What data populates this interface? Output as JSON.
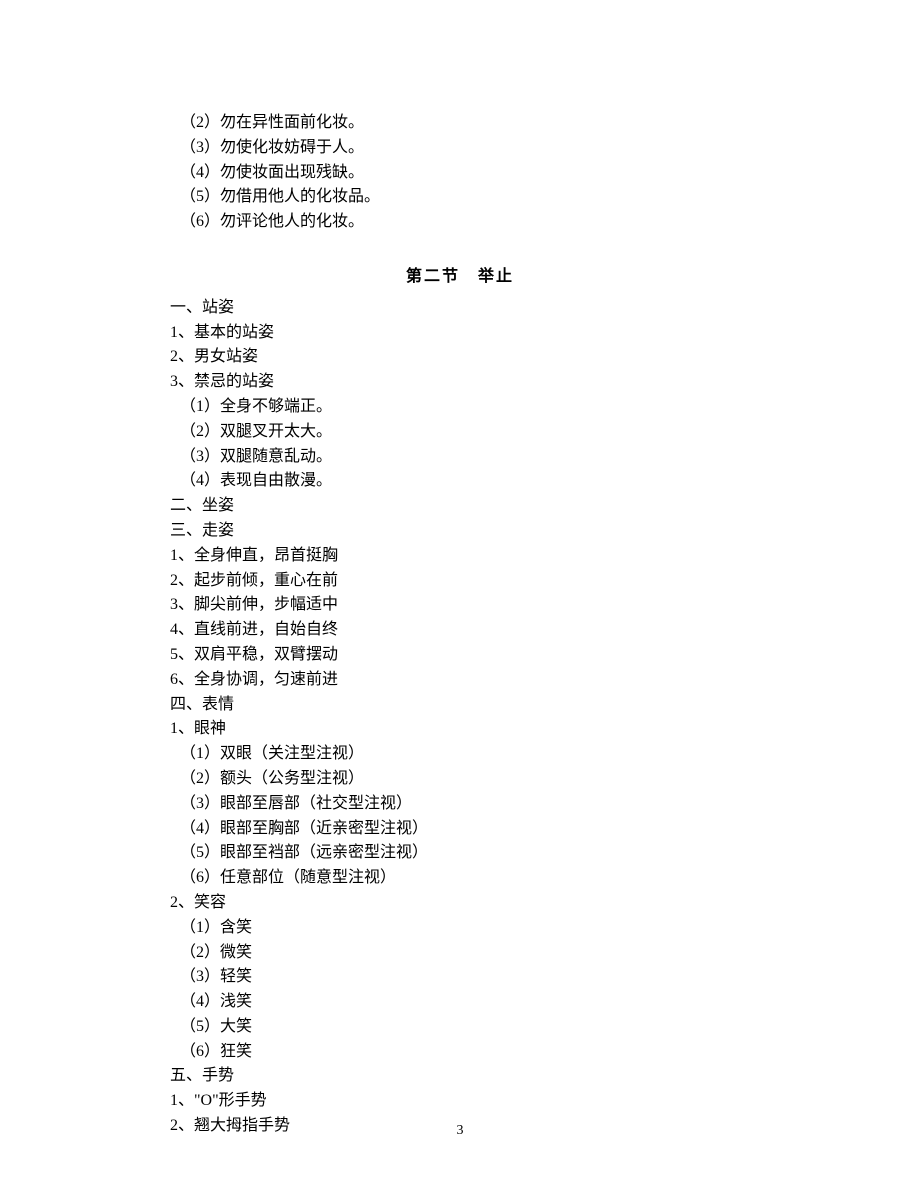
{
  "topBlock": [
    "（2）勿在异性面前化妆。",
    "（3）勿使化妆妨碍于人。",
    "（4）勿使妆面出现残缺。",
    "（5）勿借用他人的化妆品。",
    "（6）勿评论他人的化妆。"
  ],
  "sectionTitle": "第二节　举止",
  "bodyLines": [
    {
      "text": "一、站姿",
      "indent": false
    },
    {
      "text": "1、基本的站姿",
      "indent": false
    },
    {
      "text": "2、男女站姿",
      "indent": false
    },
    {
      "text": "3、禁忌的站姿",
      "indent": false
    },
    {
      "text": "（1）全身不够端正。",
      "indent": true
    },
    {
      "text": "（2）双腿叉开太大。",
      "indent": true
    },
    {
      "text": "（3）双腿随意乱动。",
      "indent": true
    },
    {
      "text": "（4）表现自由散漫。",
      "indent": true
    },
    {
      "text": "二、坐姿",
      "indent": false
    },
    {
      "text": "三、走姿",
      "indent": false
    },
    {
      "text": "1、全身伸直，昂首挺胸",
      "indent": false
    },
    {
      "text": "2、起步前倾，重心在前",
      "indent": false
    },
    {
      "text": "3、脚尖前伸，步幅适中",
      "indent": false
    },
    {
      "text": "4、直线前进，自始自终",
      "indent": false
    },
    {
      "text": "5、双肩平稳，双臂摆动",
      "indent": false
    },
    {
      "text": "6、全身协调，匀速前进",
      "indent": false
    },
    {
      "text": "四、表情",
      "indent": false
    },
    {
      "text": "1、眼神",
      "indent": false
    },
    {
      "text": "（1）双眼（关注型注视）",
      "indent": true
    },
    {
      "text": "（2）额头（公务型注视）",
      "indent": true
    },
    {
      "text": "（3）眼部至唇部（社交型注视）",
      "indent": true
    },
    {
      "text": "（4）眼部至胸部（近亲密型注视）",
      "indent": true
    },
    {
      "text": "（5）眼部至裆部（远亲密型注视）",
      "indent": true
    },
    {
      "text": "（6）任意部位（随意型注视）",
      "indent": true
    },
    {
      "text": "2、笑容",
      "indent": false
    },
    {
      "text": "（1）含笑",
      "indent": true
    },
    {
      "text": "（2）微笑",
      "indent": true
    },
    {
      "text": "（3）轻笑",
      "indent": true
    },
    {
      "text": "（4）浅笑",
      "indent": true
    },
    {
      "text": "（5）大笑",
      "indent": true
    },
    {
      "text": "（6）狂笑",
      "indent": true
    },
    {
      "text": "五、手势",
      "indent": false
    },
    {
      "text": "1、\"O\"形手势",
      "indent": false
    },
    {
      "text": "2、翘大拇指手势",
      "indent": false
    }
  ],
  "pageNumber": "3"
}
